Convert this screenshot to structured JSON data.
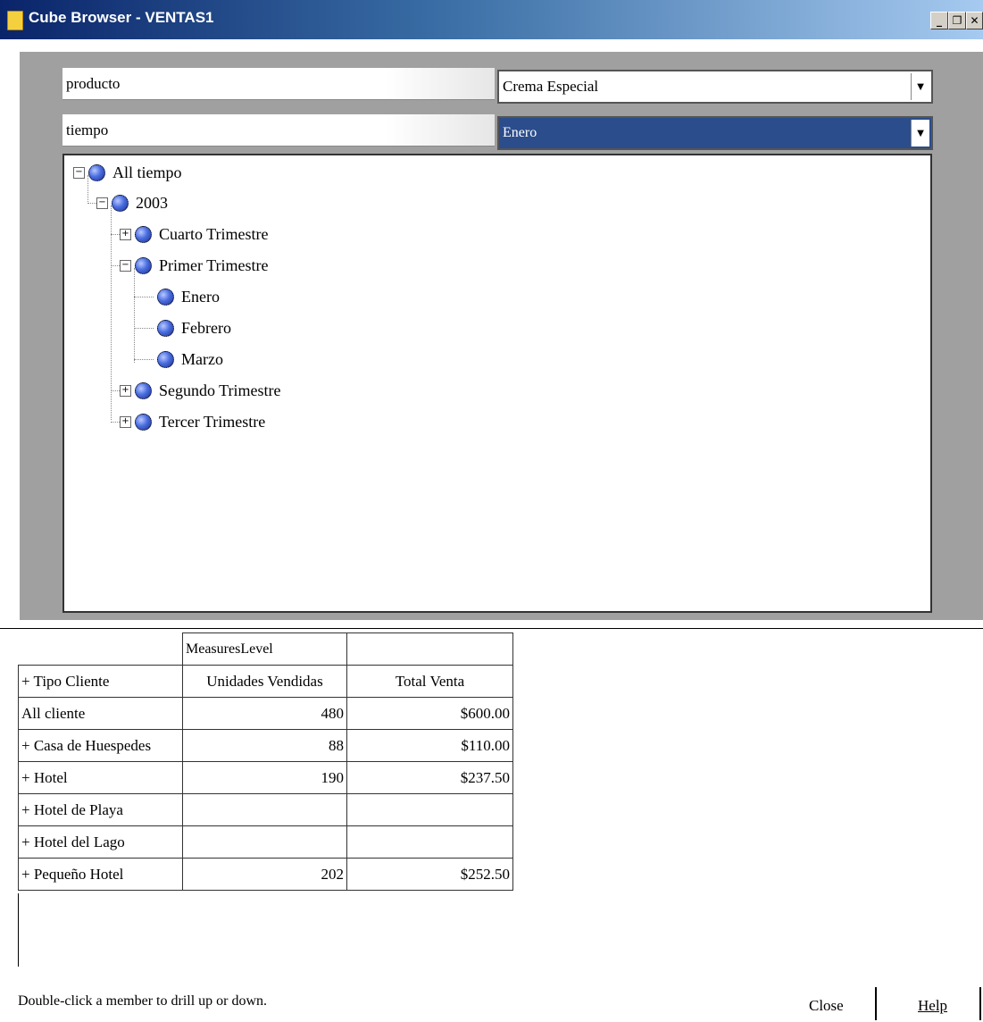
{
  "window": {
    "title": "Cube Browser - VENTAS1"
  },
  "filters": [
    {
      "dimension": "producto",
      "value": "Crema Especial"
    },
    {
      "dimension": "tiempo",
      "value": "Enero"
    }
  ],
  "tree": [
    {
      "label": "All tiempo",
      "expander": "−"
    },
    {
      "label": "2003",
      "expander": "−"
    },
    {
      "label": "Cuarto Trimestre",
      "expander": "+"
    },
    {
      "label": "Primer Trimestre",
      "expander": "−"
    },
    {
      "label": "Enero"
    },
    {
      "label": "Febrero"
    },
    {
      "label": "Marzo"
    },
    {
      "label": "Segundo Trimestre",
      "expander": "+"
    },
    {
      "label": "Tercer Trimestre",
      "expander": "+"
    }
  ],
  "grid": {
    "measures_header": "MeasuresLevel",
    "row_header": "+ Tipo Cliente",
    "columns": [
      "Unidades Vendidas",
      "Total Venta"
    ],
    "rows": [
      {
        "label": "All cliente",
        "units": "480",
        "total": "$600.00"
      },
      {
        "label": "+  Casa de Huespedes",
        "units": "88",
        "total": "$110.00"
      },
      {
        "label": "+  Hotel",
        "units": "190",
        "total": "$237.50"
      },
      {
        "label": "+  Hotel de Playa",
        "units": "",
        "total": ""
      },
      {
        "label": "+  Hotel del Lago",
        "units": "",
        "total": ""
      },
      {
        "label": "+  Pequeño Hotel",
        "units": "202",
        "total": "$252.50"
      }
    ]
  },
  "footer": {
    "hint": "Double-click a member to drill up or down.",
    "close_label": "Close",
    "help_label": "Help"
  }
}
